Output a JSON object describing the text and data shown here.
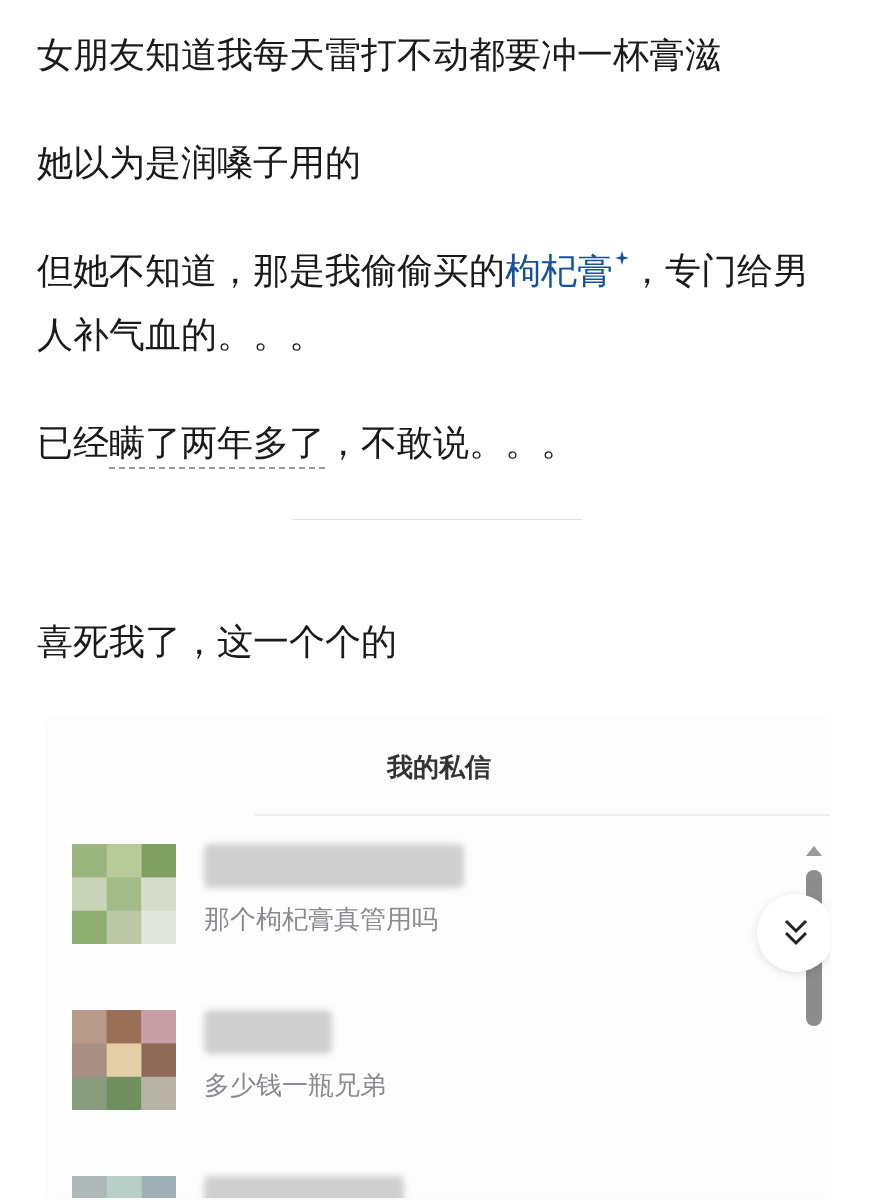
{
  "paragraphs": [
    {
      "segments": [
        {
          "kind": "plain",
          "text": "女朋友知道我每天雷打不动都要冲一杯膏滋"
        }
      ]
    },
    {
      "segments": [
        {
          "kind": "plain",
          "text": "她以为是润嗓子用的"
        }
      ]
    },
    {
      "segments": [
        {
          "kind": "plain",
          "text": "但她不知道，那是我偷偷买的"
        },
        {
          "kind": "link",
          "text": "枸杞膏"
        },
        {
          "kind": "plain",
          "text": "，专门给男人补气血的。。。"
        }
      ]
    },
    {
      "segments": [
        {
          "kind": "plain",
          "text": "已经"
        },
        {
          "kind": "annotated",
          "text": "瞒了两年多了"
        },
        {
          "kind": "plain",
          "text": "，不敢说。。。"
        }
      ]
    }
  ],
  "after_divider": [
    {
      "segments": [
        {
          "kind": "plain",
          "text": "喜死我了，这一个个的"
        }
      ]
    }
  ],
  "inbox": {
    "title": "我的私信",
    "messages": [
      {
        "kind": "message",
        "preview": "那个枸杞膏真管用吗"
      },
      {
        "kind": "message",
        "preview": "多少钱一瓶兄弟"
      },
      {
        "kind": "cut_off"
      }
    ]
  }
}
